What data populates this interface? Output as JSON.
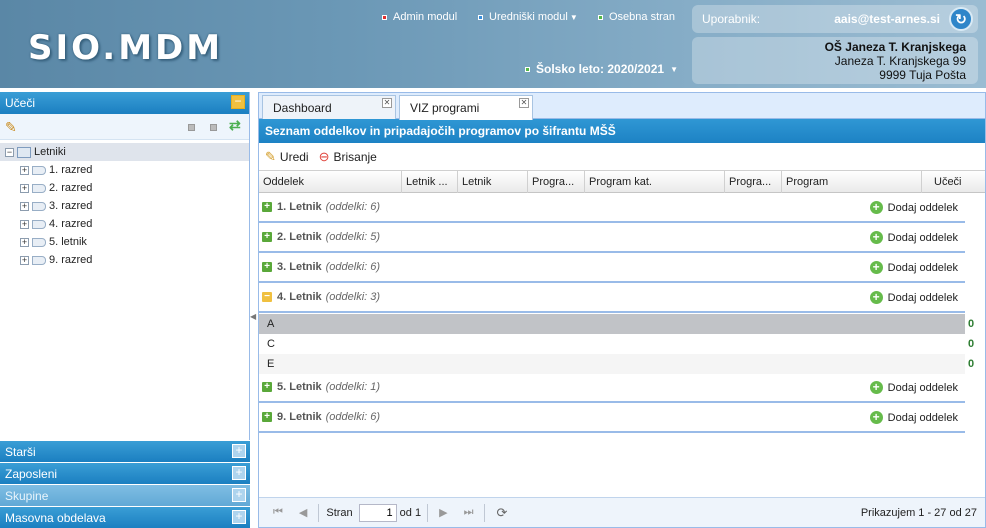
{
  "header": {
    "logo": "SIO.MDM",
    "menu": [
      {
        "label": "Admin modul",
        "color": "#e03030"
      },
      {
        "label": "Uredniški modul",
        "color": "#3a8fdc"
      },
      {
        "label": "Osebna stran",
        "color": "#54b948"
      }
    ],
    "school_year": "Šolsko leto: 2020/2021",
    "user_label": "Uporabnik:",
    "user_email": "aais@test-arnes.si",
    "school": {
      "name": "OŠ Janeza T. Kranjskega",
      "street": "Janeza T. Kranjskega 99",
      "city": "9999 Tuja Pošta"
    }
  },
  "sidebar": {
    "title": "Učeči",
    "tree": {
      "root": "Letniki",
      "items": [
        "1. razred",
        "2. razred",
        "3. razred",
        "4. razred",
        "5. letnik",
        "9. razred"
      ]
    },
    "sections": [
      "Starši",
      "Zaposleni",
      "Skupine",
      "Masovna obdelava"
    ]
  },
  "tabs": [
    {
      "label": "Dashboard"
    },
    {
      "label": "VIZ programi"
    }
  ],
  "panel": {
    "title": "Seznam oddelkov in pripadajočih programov po šifrantu MŠŠ",
    "toolbar": {
      "edit": "Uredi",
      "delete": "Brisanje"
    },
    "columns": [
      "Oddelek",
      "Letnik ...",
      "Letnik",
      "Progra...",
      "Program kat.",
      "Progra...",
      "Program",
      "Učeči"
    ],
    "add_label": "Dodaj oddelek",
    "groups": [
      {
        "name": "1. Letnik",
        "count": "(oddelki: 6)",
        "expanded": false
      },
      {
        "name": "2. Letnik",
        "count": "(oddelki: 5)",
        "expanded": false
      },
      {
        "name": "3. Letnik",
        "count": "(oddelki: 6)",
        "expanded": false
      },
      {
        "name": "4. Letnik",
        "count": "(oddelki: 3)",
        "expanded": true
      },
      {
        "name": "5. Letnik",
        "count": "(oddelki: 1)",
        "expanded": false
      },
      {
        "name": "9. Letnik",
        "count": "(oddelki: 6)",
        "expanded": false
      }
    ],
    "rows": [
      {
        "oddelek": "A",
        "ucenci": "0"
      },
      {
        "oddelek": "C",
        "ucenci": "0"
      },
      {
        "oddelek": "E",
        "ucenci": "0"
      }
    ],
    "pager": {
      "page_label": "Stran",
      "page": "1",
      "of": "od 1",
      "display": "Prikazujem 1 - 27 od 27"
    }
  }
}
